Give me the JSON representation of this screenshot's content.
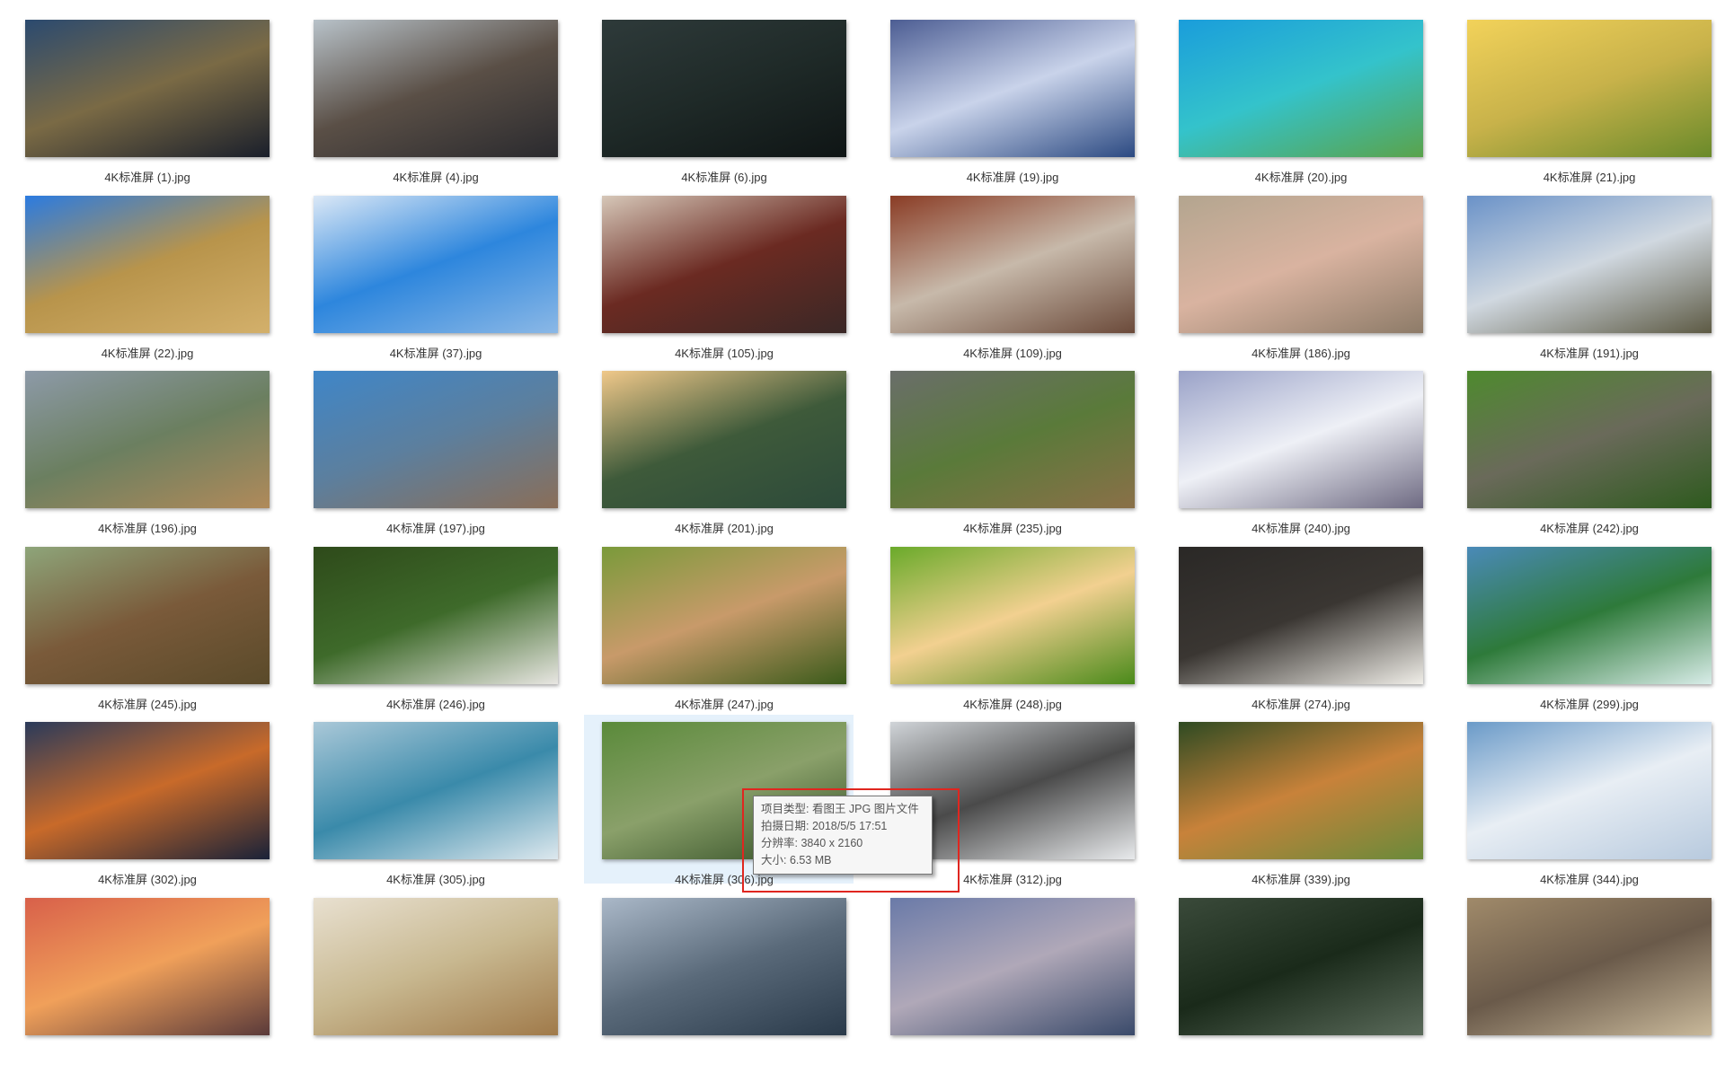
{
  "files": [
    {
      "name": "4K标准屏 (1).jpg",
      "colors": [
        "#2b4a6f",
        "#7a6a45",
        "#1a1f2b"
      ]
    },
    {
      "name": "4K标准屏 (4).jpg",
      "colors": [
        "#b8c2c9",
        "#5a4f46",
        "#2a2a2e"
      ]
    },
    {
      "name": "4K标准屏 (6).jpg",
      "colors": [
        "#2e3a3a",
        "#1f2a28",
        "#0f1515"
      ]
    },
    {
      "name": "4K标准屏 (19).jpg",
      "colors": [
        "#4c5d93",
        "#c9d3ea",
        "#2c4a82"
      ]
    },
    {
      "name": "4K标准屏 (20).jpg",
      "colors": [
        "#1a9ddb",
        "#34c3cb",
        "#5aa34b"
      ]
    },
    {
      "name": "4K标准屏 (21).jpg",
      "colors": [
        "#f2d25a",
        "#c8b24a",
        "#6a8a2a"
      ]
    },
    {
      "name": "4K标准屏 (22).jpg",
      "colors": [
        "#2b7be0",
        "#b8944b",
        "#d3b06b"
      ]
    },
    {
      "name": "4K标准屏 (37).jpg",
      "colors": [
        "#dbe8f6",
        "#2d86dd",
        "#8bb8e6"
      ]
    },
    {
      "name": "4K标准屏 (105).jpg",
      "colors": [
        "#d6c7b8",
        "#6b2a22",
        "#3a2826"
      ]
    },
    {
      "name": "4K标准屏 (109).jpg",
      "colors": [
        "#8a3c25",
        "#c7b9aa",
        "#6b4a3a"
      ]
    },
    {
      "name": "4K标准屏 (186).jpg",
      "colors": [
        "#b3a58f",
        "#d9b3a0",
        "#8d7b68"
      ]
    },
    {
      "name": "4K标准屏 (191).jpg",
      "colors": [
        "#6a92c8",
        "#d0d8e0",
        "#5d5a44"
      ]
    },
    {
      "name": "4K标准屏 (196).jpg",
      "colors": [
        "#8d9aa8",
        "#6b7f60",
        "#b08a5a"
      ]
    },
    {
      "name": "4K标准屏 (197).jpg",
      "colors": [
        "#3f86c8",
        "#5c7f9e",
        "#8a6e58"
      ]
    },
    {
      "name": "4K标准屏 (201).jpg",
      "colors": [
        "#f0c88a",
        "#3e5a3a",
        "#2d4a3a"
      ]
    },
    {
      "name": "4K标准屏 (235).jpg",
      "colors": [
        "#6a6e6a",
        "#5a7a3a",
        "#8a7048"
      ]
    },
    {
      "name": "4K标准屏 (240).jpg",
      "colors": [
        "#9aa2c8",
        "#eef0f6",
        "#6e6a82"
      ]
    },
    {
      "name": "4K标准屏 (242).jpg",
      "colors": [
        "#4e8a2e",
        "#6a6a5a",
        "#2e5a1e"
      ]
    },
    {
      "name": "4K标准屏 (245).jpg",
      "colors": [
        "#8ea57a",
        "#7a5a3a",
        "#5a4a2a"
      ]
    },
    {
      "name": "4K标准屏 (246).jpg",
      "colors": [
        "#2e4a1a",
        "#3e6a2a",
        "#e8e6e2"
      ]
    },
    {
      "name": "4K标准屏 (247).jpg",
      "colors": [
        "#7a9a3a",
        "#c89a6a",
        "#3a5a1a"
      ]
    },
    {
      "name": "4K标准屏 (248).jpg",
      "colors": [
        "#6aaa2a",
        "#f2d090",
        "#4a8a1a"
      ]
    },
    {
      "name": "4K标准屏 (274).jpg",
      "colors": [
        "#2a2826",
        "#3a3632",
        "#f0eee8"
      ]
    },
    {
      "name": "4K标准屏 (299).jpg",
      "colors": [
        "#4a8ab8",
        "#2e7a3a",
        "#d8ece8"
      ]
    },
    {
      "name": "4K标准屏 (302).jpg",
      "colors": [
        "#2a3a5a",
        "#c86a2a",
        "#1a2238"
      ]
    },
    {
      "name": "4K标准屏 (305).jpg",
      "colors": [
        "#aac8d8",
        "#3a8aaa",
        "#dde8ee"
      ]
    },
    {
      "name": "4K标准屏 (306).jpg",
      "colors": [
        "#5a8a3a",
        "#8aa06a",
        "#2e4a22"
      ]
    },
    {
      "name": "4K标准屏 (312).jpg",
      "colors": [
        "#d0d4d8",
        "#4a4a4a",
        "#e8eaec"
      ]
    },
    {
      "name": "4K标准屏 (339).jpg",
      "colors": [
        "#2e4a22",
        "#c8823a",
        "#6a8a3a"
      ]
    },
    {
      "name": "4K标准屏 (344).jpg",
      "colors": [
        "#6a9ac8",
        "#e8eef4",
        "#b8cade"
      ]
    },
    {
      "name": "",
      "colors": [
        "#d8604a",
        "#f0a05a",
        "#5a3a3a"
      ]
    },
    {
      "name": "",
      "colors": [
        "#e8e0d0",
        "#c8b890",
        "#a07a4a"
      ]
    },
    {
      "name": "",
      "colors": [
        "#aab8c8",
        "#5a6a7a",
        "#2a3a4a"
      ]
    },
    {
      "name": "",
      "colors": [
        "#6a7aa8",
        "#b0a8b8",
        "#3a4a6a"
      ]
    },
    {
      "name": "",
      "colors": [
        "#3a4a3a",
        "#1a2a1a",
        "#5a6a5a"
      ]
    },
    {
      "name": "",
      "colors": [
        "#a08a6a",
        "#6a5a4a",
        "#c8b89a"
      ]
    }
  ],
  "selected_index": 26,
  "tooltip": {
    "type_line": "项目类型: 看图王 JPG 图片文件",
    "date_line": "拍摄日期: 2018/5/5 17:51",
    "resolution_line": "分辨率: 3840 x 2160",
    "size_line": "大小: 6.53 MB"
  }
}
